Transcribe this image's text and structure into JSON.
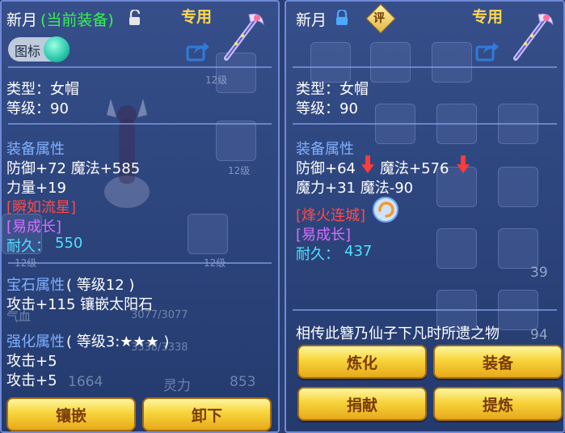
{
  "left": {
    "item_name": "新月",
    "equip_status": "(当前装备)",
    "exclusive_label": "专用",
    "icon_badge": "图标",
    "type_line": "类型：女帽",
    "level_line": "等级：90",
    "attr_heading": "装备属性",
    "attr_line1": "防御+72 魔法+585",
    "attr_line2": "力量+19",
    "special_skill": "[瞬如流星]",
    "special_effect": "[易成长]",
    "durability_label": "耐久：",
    "durability_value": "550",
    "gem_heading": "宝石属性",
    "gem_level": "( 等级12 )",
    "gem_line": "攻击+115 镶嵌太阳石",
    "enhance_heading": "强化属性",
    "enhance_level": "( 等级3:★★★ )",
    "enhance_line1": "攻击+5",
    "enhance_line2": "攻击+5",
    "bg_texts": {
      "level_tag_1": "12级",
      "level_tag_2": "12级",
      "level_tag_3": "12级",
      "level_tag_4": "12级",
      "hp_label": "气血",
      "hp_value": "3077/3077",
      "mp_value": "3338/3338",
      "stat_value": "1664",
      "stat_label": "灵力",
      "stat_value2": "853"
    },
    "buttons": {
      "inlay": "镶嵌",
      "unequip": "卸下"
    }
  },
  "right": {
    "item_name": "新月",
    "review_badge": "评",
    "exclusive_label": "专用",
    "type_line": "类型：女帽",
    "level_line": "等级：90",
    "attr_heading": "装备属性",
    "attr_line1_a": "防御+64",
    "attr_line1_b": "魔法+576",
    "attr_line2": "魔力+31 魔法-90",
    "special_skill": "[烽火连城]",
    "special_effect": "[易成长]",
    "durability_label": "耐久：",
    "durability_value": "437",
    "description": "相传此簪乃仙子下凡时所遗之物",
    "bg_texts": {
      "count_1": "39",
      "count_2": "94"
    },
    "buttons": {
      "refine": "炼化",
      "equip": "装备",
      "donate": "捐献",
      "extract": "提炼"
    }
  }
}
